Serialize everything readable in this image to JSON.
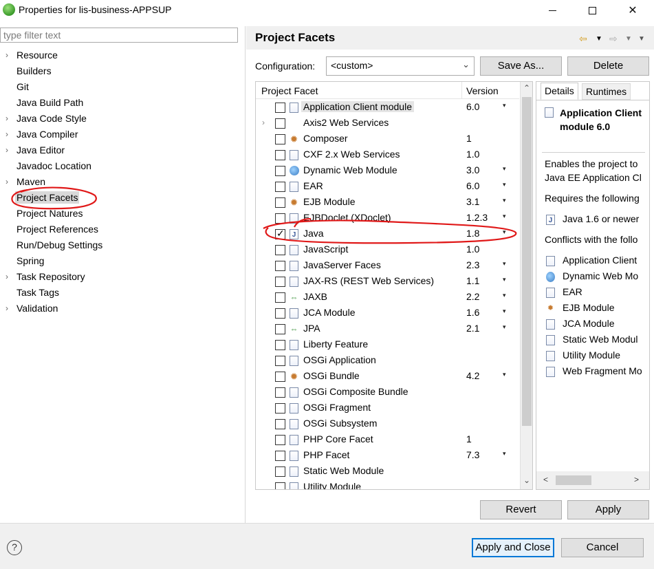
{
  "window": {
    "title": "Properties for lis-business-APPSUP"
  },
  "left": {
    "filter_placeholder": "type filter text",
    "tree": [
      {
        "label": "Resource",
        "expandable": true
      },
      {
        "label": "Builders",
        "expandable": false
      },
      {
        "label": "Git",
        "expandable": false
      },
      {
        "label": "Java Build Path",
        "expandable": false
      },
      {
        "label": "Java Code Style",
        "expandable": true
      },
      {
        "label": "Java Compiler",
        "expandable": true
      },
      {
        "label": "Java Editor",
        "expandable": true
      },
      {
        "label": "Javadoc Location",
        "expandable": false
      },
      {
        "label": "Maven",
        "expandable": true
      },
      {
        "label": "Project Facets",
        "expandable": false,
        "selected": true
      },
      {
        "label": "Project Natures",
        "expandable": false
      },
      {
        "label": "Project References",
        "expandable": false
      },
      {
        "label": "Run/Debug Settings",
        "expandable": false
      },
      {
        "label": "Spring",
        "expandable": false
      },
      {
        "label": "Task Repository",
        "expandable": true
      },
      {
        "label": "Task Tags",
        "expandable": false
      },
      {
        "label": "Validation",
        "expandable": true
      }
    ]
  },
  "page": {
    "title": "Project Facets",
    "config_label": "Configuration:",
    "config_value": "<custom>",
    "save_as": "Save As...",
    "delete": "Delete",
    "col_facet": "Project Facet",
    "col_version": "Version",
    "facets": [
      {
        "name": "Application Client module",
        "version": "6.0",
        "dropdown": true,
        "checked": false,
        "icon": "doc",
        "highlight": true
      },
      {
        "name": "Axis2 Web Services",
        "version": "",
        "dropdown": false,
        "checked": false,
        "icon": "none",
        "expand": true
      },
      {
        "name": "Composer",
        "version": "1",
        "dropdown": false,
        "checked": false,
        "icon": "gear"
      },
      {
        "name": "CXF 2.x Web Services",
        "version": "1.0",
        "dropdown": false,
        "checked": false,
        "icon": "doc"
      },
      {
        "name": "Dynamic Web Module",
        "version": "3.0",
        "dropdown": true,
        "checked": false,
        "icon": "globe"
      },
      {
        "name": "EAR",
        "version": "6.0",
        "dropdown": true,
        "checked": false,
        "icon": "doc"
      },
      {
        "name": "EJB Module",
        "version": "3.1",
        "dropdown": true,
        "checked": false,
        "icon": "gear"
      },
      {
        "name": "EJBDoclet (XDoclet)",
        "version": "1.2.3",
        "dropdown": true,
        "checked": false,
        "icon": "doc"
      },
      {
        "name": "Java",
        "version": "1.8",
        "dropdown": true,
        "checked": true,
        "icon": "java"
      },
      {
        "name": "JavaScript",
        "version": "1.0",
        "dropdown": false,
        "checked": false,
        "icon": "doc"
      },
      {
        "name": "JavaServer Faces",
        "version": "2.3",
        "dropdown": true,
        "checked": false,
        "icon": "doc"
      },
      {
        "name": "JAX-RS (REST Web Services)",
        "version": "1.1",
        "dropdown": true,
        "checked": false,
        "icon": "doc"
      },
      {
        "name": "JAXB",
        "version": "2.2",
        "dropdown": true,
        "checked": false,
        "icon": "arrow"
      },
      {
        "name": "JCA Module",
        "version": "1.6",
        "dropdown": true,
        "checked": false,
        "icon": "doc"
      },
      {
        "name": "JPA",
        "version": "2.1",
        "dropdown": true,
        "checked": false,
        "icon": "arrow"
      },
      {
        "name": "Liberty Feature",
        "version": "",
        "dropdown": false,
        "checked": false,
        "icon": "doc"
      },
      {
        "name": "OSGi Application",
        "version": "",
        "dropdown": false,
        "checked": false,
        "icon": "doc"
      },
      {
        "name": "OSGi Bundle",
        "version": "4.2",
        "dropdown": true,
        "checked": false,
        "icon": "gear"
      },
      {
        "name": "OSGi Composite Bundle",
        "version": "",
        "dropdown": false,
        "checked": false,
        "icon": "doc"
      },
      {
        "name": "OSGi Fragment",
        "version": "",
        "dropdown": false,
        "checked": false,
        "icon": "doc"
      },
      {
        "name": "OSGi Subsystem",
        "version": "",
        "dropdown": false,
        "checked": false,
        "icon": "doc"
      },
      {
        "name": "PHP Core Facet",
        "version": "1",
        "dropdown": false,
        "checked": false,
        "icon": "doc"
      },
      {
        "name": "PHP Facet",
        "version": "7.3",
        "dropdown": true,
        "checked": false,
        "icon": "doc"
      },
      {
        "name": "Static Web Module",
        "version": "",
        "dropdown": false,
        "checked": false,
        "icon": "doc"
      },
      {
        "name": "Utility Module",
        "version": "",
        "dropdown": false,
        "checked": false,
        "icon": "doc"
      }
    ],
    "details": {
      "tab_details": "Details",
      "tab_runtimes": "Runtimes",
      "title": "Application Client module 6.0",
      "enables_1": "Enables the project to",
      "enables_2": "Java EE Application Cl",
      "requires": "Requires the following",
      "requires_item": "Java 1.6 or newer",
      "conflicts": "Conflicts with the follo",
      "conflict_items": [
        "Application Client",
        "Dynamic Web Mo",
        "EAR",
        "EJB Module",
        "JCA Module",
        "Static Web Modul",
        "Utility Module",
        "Web Fragment Mo"
      ],
      "conflict_icons": [
        "doc",
        "globe",
        "doc",
        "gear",
        "doc",
        "doc",
        "doc",
        "doc"
      ]
    },
    "revert": "Revert",
    "apply": "Apply"
  },
  "footer": {
    "help": "?",
    "apply_close": "Apply and Close",
    "cancel": "Cancel"
  }
}
